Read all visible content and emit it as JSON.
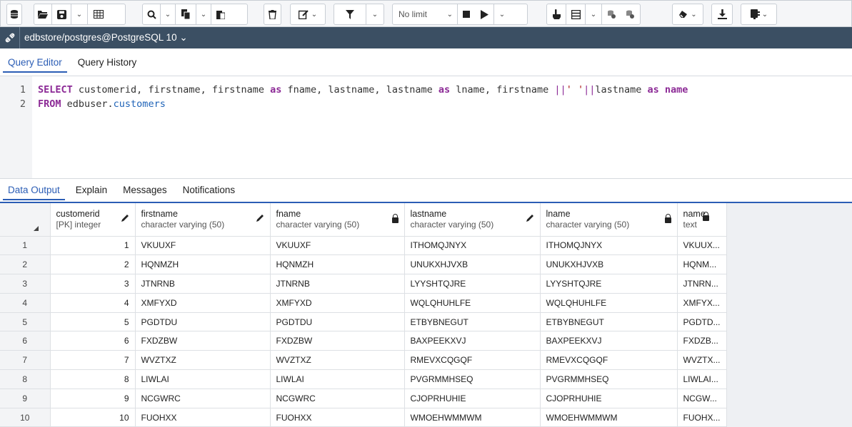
{
  "toolbar": {
    "limit_label": "No limit",
    "icons": [
      "database-icon",
      "open-file-icon",
      "save-icon",
      "chevron-down-icon",
      "grid-icon",
      "search-icon",
      "copy-icon",
      "paste-icon",
      "delete-icon",
      "edit-icon",
      "filter-icon",
      "stop-icon",
      "play-icon",
      "explain-icon",
      "commit-icon",
      "rollback-icon",
      "clear-icon",
      "download-icon",
      "macros-icon"
    ]
  },
  "connection": {
    "label": "edbstore/postgres@PostgreSQL 10 ⌄"
  },
  "editor_tabs": [
    "Query Editor",
    "Query History"
  ],
  "editor": {
    "line_numbers": [
      "1",
      "2"
    ],
    "line1": {
      "kw1": "SELECT",
      "p1": " customerid, firstname, firstname ",
      "kw2": "as",
      "p2": " fname, lastname, lastname ",
      "kw3": "as",
      "p3": " lname, firstname ",
      "op1": "||",
      "str1": "' '",
      "op2": "||",
      "p4": "lastname ",
      "kw4": "as",
      "p5": " ",
      "kw5": "name"
    },
    "line2": {
      "kw1": "FROM",
      "p1": " edbuser.",
      "tbl": "customers"
    }
  },
  "output_tabs": [
    "Data Output",
    "Explain",
    "Messages",
    "Notifications"
  ],
  "grid": {
    "columns": [
      {
        "name": "customerid",
        "type": "[PK] integer",
        "icon": "pencil-icon"
      },
      {
        "name": "firstname",
        "type": "character varying (50)",
        "icon": "pencil-icon"
      },
      {
        "name": "fname",
        "type": "character varying (50)",
        "icon": "lock-icon"
      },
      {
        "name": "lastname",
        "type": "character varying (50)",
        "icon": "pencil-icon"
      },
      {
        "name": "lname",
        "type": "character varying (50)",
        "icon": "lock-icon"
      },
      {
        "name": "name",
        "type": "text",
        "icon": "lock-icon"
      }
    ],
    "rows": [
      [
        "1",
        "1",
        "VKUUXF",
        "VKUUXF",
        "ITHOMQJNYX",
        "ITHOMQJNYX",
        "VKUUX..."
      ],
      [
        "2",
        "2",
        "HQNMZH",
        "HQNMZH",
        "UNUKXHJVXB",
        "UNUKXHJVXB",
        "HQNM..."
      ],
      [
        "3",
        "3",
        "JTNRNB",
        "JTNRNB",
        "LYYSHTQJRE",
        "LYYSHTQJRE",
        "JTNRN..."
      ],
      [
        "4",
        "4",
        "XMFYXD",
        "XMFYXD",
        "WQLQHUHLFE",
        "WQLQHUHLFE",
        "XMFYX..."
      ],
      [
        "5",
        "5",
        "PGDTDU",
        "PGDTDU",
        "ETBYBNEGUT",
        "ETBYBNEGUT",
        "PGDTD..."
      ],
      [
        "6",
        "6",
        "FXDZBW",
        "FXDZBW",
        "BAXPEEKXVJ",
        "BAXPEEKXVJ",
        "FXDZB..."
      ],
      [
        "7",
        "7",
        "WVZTXZ",
        "WVZTXZ",
        "RMEVXCQGQF",
        "RMEVXCQGQF",
        "WVZTX..."
      ],
      [
        "8",
        "8",
        "LIWLAI",
        "LIWLAI",
        "PVGRMMHSEQ",
        "PVGRMMHSEQ",
        "LIWLAI..."
      ],
      [
        "9",
        "9",
        "NCGWRC",
        "NCGWRC",
        "CJOPRHUHIE",
        "CJOPRHUHIE",
        "NCGW..."
      ],
      [
        "10",
        "10",
        "FUOHXX",
        "FUOHXX",
        "WMOEHWMMWM",
        "WMOEHWMMWM",
        "FUOHX..."
      ]
    ]
  }
}
